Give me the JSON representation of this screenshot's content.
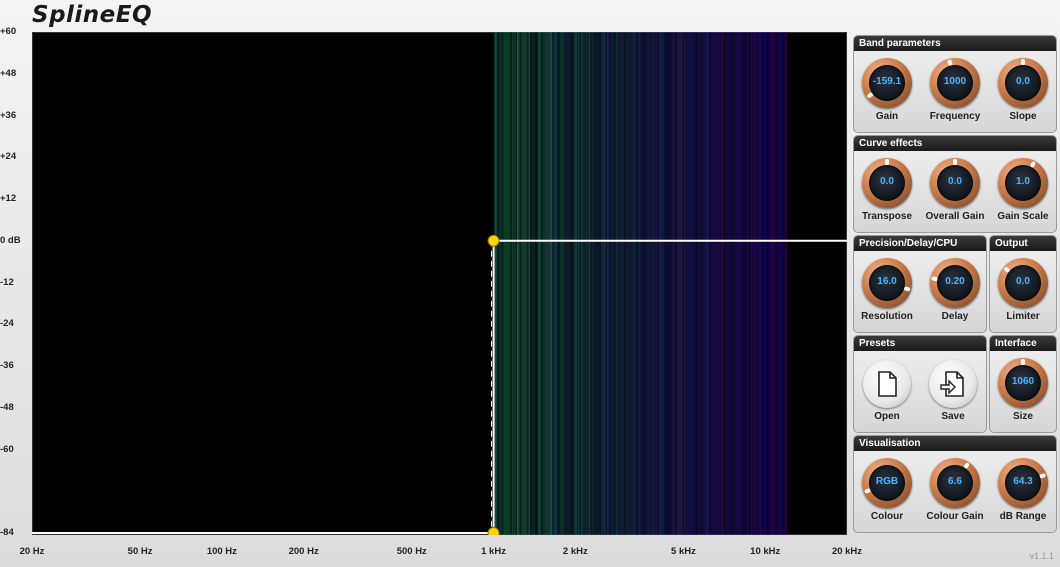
{
  "app": {
    "logo": "SplineEQ",
    "version": "v1.1.1"
  },
  "graph": {
    "y_ticks": [
      {
        "label": "+60",
        "db": 60
      },
      {
        "label": "+48",
        "db": 48
      },
      {
        "label": "+36",
        "db": 36
      },
      {
        "label": "+24",
        "db": 24
      },
      {
        "label": "+12",
        "db": 12
      },
      {
        "label": "0 dB",
        "db": 0
      },
      {
        "label": "-12",
        "db": -12
      },
      {
        "label": "-24",
        "db": -24
      },
      {
        "label": "-36",
        "db": -36
      },
      {
        "label": "-48",
        "db": -48
      },
      {
        "label": "-60",
        "db": -60
      },
      {
        "label": "-84",
        "db": -84
      }
    ],
    "x_ticks": [
      {
        "label": "20 Hz",
        "hz": 20
      },
      {
        "label": "50 Hz",
        "hz": 50
      },
      {
        "label": "100 Hz",
        "hz": 100
      },
      {
        "label": "200 Hz",
        "hz": 200
      },
      {
        "label": "500 Hz",
        "hz": 500
      },
      {
        "label": "1 kHz",
        "hz": 1000
      },
      {
        "label": "2 kHz",
        "hz": 2000
      },
      {
        "label": "5 kHz",
        "hz": 5000
      },
      {
        "label": "10 kHz",
        "hz": 10000
      },
      {
        "label": "20 kHz",
        "hz": 20000
      }
    ],
    "curve_points": [
      {
        "hz": 20,
        "db": -84
      },
      {
        "hz": 1000,
        "db": -84
      },
      {
        "hz": 1000,
        "db": 0
      },
      {
        "hz": 20000,
        "db": 0
      }
    ],
    "nodes": [
      {
        "hz": 1000,
        "db": 0
      },
      {
        "hz": 1000,
        "db": -84
      }
    ],
    "colors": {
      "curve": "#ffffff",
      "node": "#ffd400",
      "background": "#000000"
    }
  },
  "panels": {
    "band": {
      "title": "Band parameters",
      "knobs": [
        {
          "label": "Gain",
          "value": "-159.1",
          "fraction": 0.05
        },
        {
          "label": "Frequency",
          "value": "1000",
          "fraction": 0.45
        },
        {
          "label": "Slope",
          "value": "0.0",
          "fraction": 0.5
        }
      ]
    },
    "curve": {
      "title": "Curve effects",
      "knobs": [
        {
          "label": "Transpose",
          "value": "0.0",
          "fraction": 0.5
        },
        {
          "label": "Overall Gain",
          "value": "0.0",
          "fraction": 0.5
        },
        {
          "label": "Gain Scale",
          "value": "1.0",
          "fraction": 0.6
        }
      ]
    },
    "precision": {
      "title": "Precision/Delay/CPU",
      "knobs": [
        {
          "label": "Resolution",
          "value": "16.0",
          "fraction": 0.88
        },
        {
          "label": "Delay",
          "value": "0.20",
          "fraction": 0.22
        }
      ]
    },
    "output": {
      "title": "Output",
      "knobs": [
        {
          "label": "Limiter",
          "value": "0.0",
          "fraction": 0.32
        }
      ]
    },
    "presets": {
      "title": "Presets",
      "buttons": [
        {
          "label": "Open",
          "icon": "file-icon"
        },
        {
          "label": "Save",
          "icon": "file-save-icon"
        }
      ]
    },
    "interface": {
      "title": "Interface",
      "knobs": [
        {
          "label": "Size",
          "value": "1060",
          "fraction": 0.5
        }
      ]
    },
    "visualisation": {
      "title": "Visualisation",
      "knobs": [
        {
          "label": "Colour",
          "value": "RGB",
          "fraction": 0.1
        },
        {
          "label": "Colour Gain",
          "value": "6.6",
          "fraction": 0.62
        },
        {
          "label": "dB Range",
          "value": "64.3",
          "fraction": 0.75
        }
      ]
    }
  }
}
